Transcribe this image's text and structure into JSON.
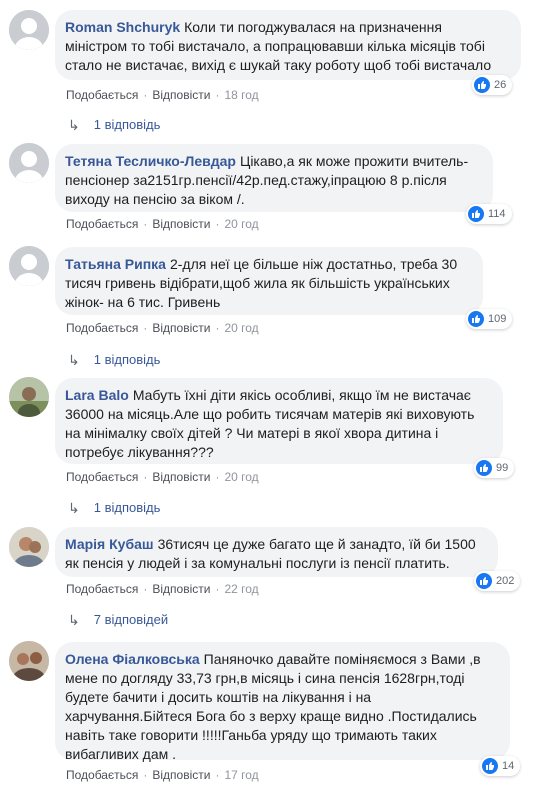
{
  "ui": {
    "like": "Подобається",
    "reply": "Відповісти",
    "like_color": "#1877f2",
    "author_color": "#385898"
  },
  "comments": [
    {
      "author": "Roman Shchuryk",
      "text": "Коли ти погоджувалася на призначення\nміністром то тобі вистачало, а попрацювавши кілька місяців тобі\nстало не вистачає, вихід є шукай таку роботу щоб тобі вистачало",
      "time": "18 год",
      "reactions": "26",
      "replies": "1 відповідь"
    },
    {
      "author": "Тетяна Тесличко-Левдар",
      "text": "Цікаво,а як може прожити вчитель-\nпенсіонер за2151гр.пенсії/42р.пед.стажу,іпрацюю 8 р.після\nвиходу на пенсію за віком /.",
      "time": "20 год",
      "reactions": "114"
    },
    {
      "author": "Татьяна Рипка",
      "text": "2-для неї це більше ніж достатньо, треба 30\nтисяч гривень відібрати,щоб жила як більшість українських\nжінок- на 6 тис. Гривень",
      "time": "20 год",
      "reactions": "109",
      "replies": "1 відповідь"
    },
    {
      "author": "Lara Balo",
      "text": "Мабуть їхні діти якісь особливі, якщо їм не вистачає\n36000 на місяць.Але що робить тисячам матерів які виховують\nна мінімалку своїх дітей ? Чи матері в якої хвора дитина і\nпотребує лікування???",
      "time": "20 год",
      "reactions": "99",
      "replies": "1 відповідь"
    },
    {
      "author": "Марія Кубаш",
      "text": "36тисяч це дуже багато ще й занадто, їй би 1500\nяк пенсія у людей і за комунальні послуги із пенсії платить.",
      "time": "22 год",
      "reactions": "202",
      "replies": "7 відповідей"
    },
    {
      "author": "Олена Фіалковська",
      "text": "Паняночко давайте поміняємося з Вами ,в\nмене по догляду 33,73 грн,в місяць і сина пенсія 1628грн,тоді\nбудете бачити і досить коштів на лікування і на\nхарчування.Бійтеся Бога бо з верху краще видно .Постидались\nнавіть таке говорити !!!!!Ганьба уряду що тримають таких\nвибагливих дам .",
      "time": "17 год",
      "reactions": "14"
    }
  ]
}
